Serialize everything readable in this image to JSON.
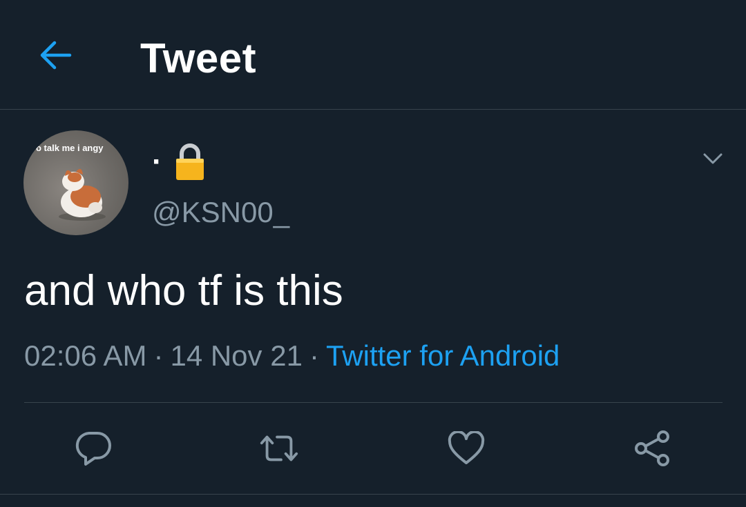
{
  "header": {
    "title": "Tweet",
    "back_icon": "arrow-left-icon"
  },
  "colors": {
    "background": "#15202b",
    "accent": "#1da1f2",
    "secondary_text": "#8899a6",
    "divider": "#38444d"
  },
  "author": {
    "display_name": "·",
    "locked_icon": "lock-icon",
    "handle": "@KSN00_",
    "avatar_caption": "o talk me i angy"
  },
  "tweet": {
    "text": "and who tf is this",
    "time": "02:06 AM",
    "date": "14 Nov 21",
    "separator": "·",
    "source": "Twitter for Android"
  },
  "actions": [
    {
      "name": "reply",
      "icon": "reply-icon"
    },
    {
      "name": "retweet",
      "icon": "retweet-icon"
    },
    {
      "name": "like",
      "icon": "heart-icon"
    },
    {
      "name": "share",
      "icon": "share-icon"
    }
  ]
}
